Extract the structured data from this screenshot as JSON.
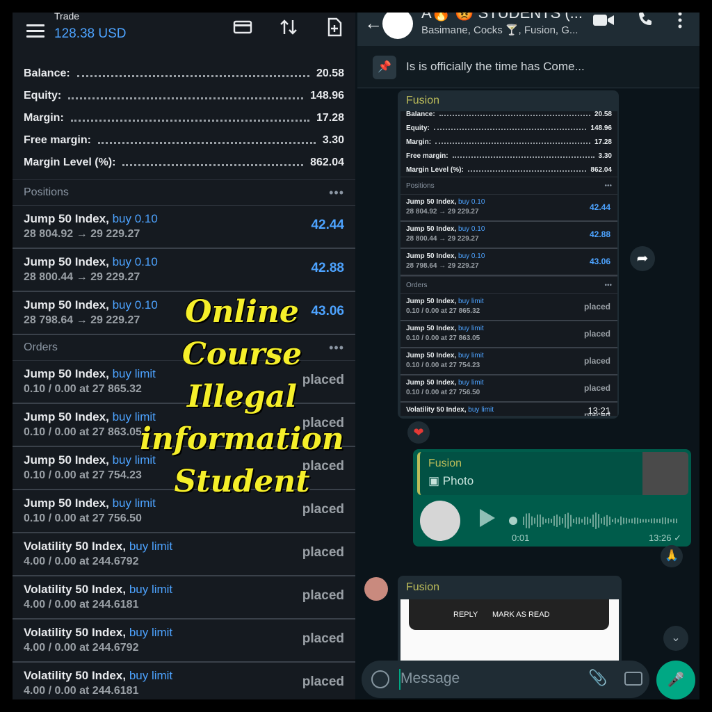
{
  "trade": {
    "title": "Trade",
    "balance_usd": "128.38 USD",
    "account": [
      {
        "label": "Balance:",
        "value": "20.58"
      },
      {
        "label": "Equity:",
        "value": "148.96"
      },
      {
        "label": "Margin:",
        "value": "17.28"
      },
      {
        "label": "Free margin:",
        "value": "3.30"
      },
      {
        "label": "Margin Level (%):",
        "value": "862.04"
      }
    ],
    "positions_label": "Positions",
    "more": "•••",
    "positions": [
      {
        "symbol": "Jump 50 Index,",
        "type": "buy 0.10",
        "detail": "28 804.92 → 29 229.27",
        "value": "42.44"
      },
      {
        "symbol": "Jump 50 Index,",
        "type": "buy 0.10",
        "detail": "28 800.44 → 29 229.27",
        "value": "42.88"
      },
      {
        "symbol": "Jump 50 Index,",
        "type": "buy 0.10",
        "detail": "28 798.64 → 29 229.27",
        "value": "43.06"
      }
    ],
    "orders_label": "Orders",
    "orders": [
      {
        "symbol": "Jump 50 Index,",
        "type": "buy limit",
        "detail": "0.10 / 0.00 at 27 865.32",
        "status": "placed"
      },
      {
        "symbol": "Jump 50 Index,",
        "type": "buy limit",
        "detail": "0.10 / 0.00 at 27 863.05",
        "status": "placed"
      },
      {
        "symbol": "Jump 50 Index,",
        "type": "buy limit",
        "detail": "0.10 / 0.00 at 27 754.23",
        "status": "placed"
      },
      {
        "symbol": "Jump 50 Index,",
        "type": "buy limit",
        "detail": "0.10 / 0.00 at 27 756.50",
        "status": "placed"
      },
      {
        "symbol": "Volatility 50 Index,",
        "type": "buy limit",
        "detail": "4.00 / 0.00 at 244.6792",
        "status": "placed"
      },
      {
        "symbol": "Volatility 50 Index,",
        "type": "buy limit",
        "detail": "4.00 / 0.00 at 244.6181",
        "status": "placed"
      },
      {
        "symbol": "Volatility 50 Index,",
        "type": "buy limit",
        "detail": "4.00 / 0.00 at 244.6792",
        "status": "placed"
      },
      {
        "symbol": "Volatility 50 Index,",
        "type": "buy limit",
        "detail": "4.00 / 0.00 at 244.6181",
        "status": "placed"
      }
    ]
  },
  "overlay": {
    "line1": "Online",
    "line2": "Course",
    "line3": "Illegal information",
    "line4": "Student"
  },
  "chat": {
    "title": "A🔥 😡 STUDENTS (...",
    "subtitle": "Basimane, Cocks 🍸, Fusion, G...",
    "pinned": "Is is officially the time has Come...",
    "msg1": {
      "sender": "Fusion",
      "time": "13:21",
      "reaction": "❤",
      "shot_account": [
        {
          "label": "Balance:",
          "value": "20.58"
        },
        {
          "label": "Equity:",
          "value": "148.96"
        },
        {
          "label": "Margin:",
          "value": "17.28"
        },
        {
          "label": "Free margin:",
          "value": "3.30"
        },
        {
          "label": "Margin Level (%):",
          "value": "862.04"
        }
      ],
      "shot_positions": [
        {
          "symbol": "Jump 50 Index,",
          "type": "buy 0.10",
          "detail": "28 804.92 → 29 229.27",
          "value": "42.44"
        },
        {
          "symbol": "Jump 50 Index,",
          "type": "buy 0.10",
          "detail": "28 800.44 → 29 229.27",
          "value": "42.88"
        },
        {
          "symbol": "Jump 50 Index,",
          "type": "buy 0.10",
          "detail": "28 798.64 → 29 229.27",
          "value": "43.06"
        }
      ],
      "shot_orders": [
        {
          "symbol": "Jump 50 Index,",
          "type": "buy limit",
          "detail": "0.10 / 0.00 at 27 865.32",
          "status": "placed"
        },
        {
          "symbol": "Jump 50 Index,",
          "type": "buy limit",
          "detail": "0.10 / 0.00 at 27 863.05",
          "status": "placed"
        },
        {
          "symbol": "Jump 50 Index,",
          "type": "buy limit",
          "detail": "0.10 / 0.00 at 27 754.23",
          "status": "placed"
        },
        {
          "symbol": "Jump 50 Index,",
          "type": "buy limit",
          "detail": "0.10 / 0.00 at 27 756.50",
          "status": "placed"
        },
        {
          "symbol": "Volatility 50 Index,",
          "type": "buy limit",
          "detail": "",
          "status": "placed"
        }
      ]
    },
    "msg2": {
      "quote_sender": "Fusion",
      "quote_type": "▣ Photo",
      "duration": "0:01",
      "time": "13:26 ✓",
      "reaction": "🙏"
    },
    "msg3": {
      "sender": "Fusion",
      "reply": "REPLY",
      "mark_read": "MARK AS READ"
    },
    "composer_placeholder": "Message",
    "colors": {
      "accent": "#00a884",
      "outgoing": "#005c4b",
      "link_blue": "#4da3ff",
      "overlay_yellow": "#f5ef2a"
    }
  }
}
